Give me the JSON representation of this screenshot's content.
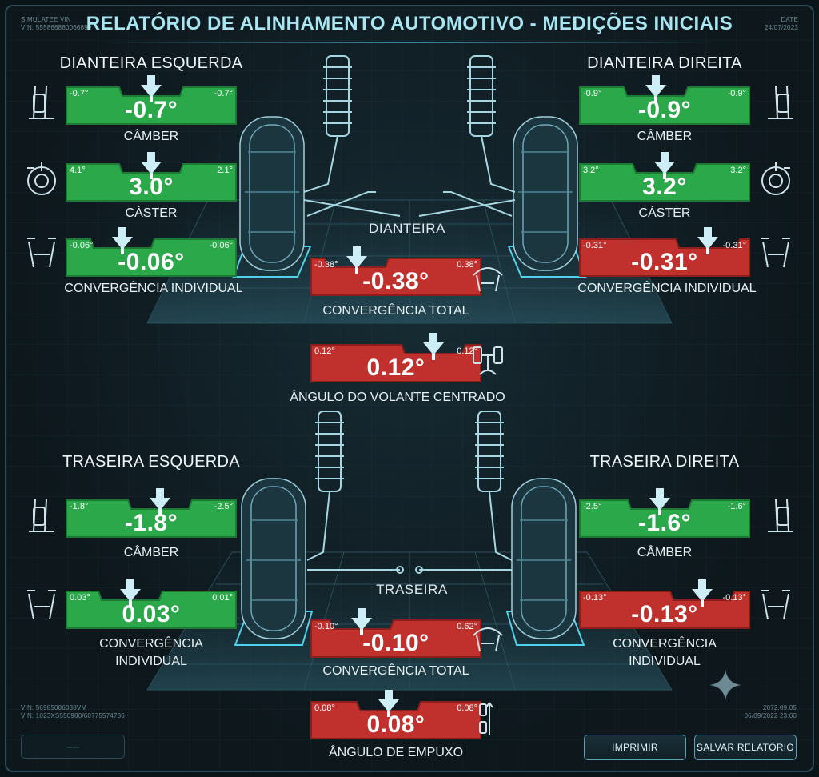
{
  "header": {
    "title": "RELATÓRIO DE ALINHAMENTO AUTOMOTIVO - MEDIÇÕES INICIAIS",
    "vin_label": "SIMULATEE VIN",
    "vin_value": "VIN: 555866880066899",
    "date_label": "DATE",
    "date_value": "24/07/2023"
  },
  "front": {
    "axle_label": "DIANTEIRA",
    "left_title": "DIANTEIRA ESQUERDA",
    "right_title": "DIANTEIRA DIREITA",
    "left": {
      "camber": {
        "label": "CÂMBER",
        "value": "-0.7°",
        "min": "-0.7°",
        "max": "-0.7°",
        "status": "ok",
        "marker": 0.5
      },
      "caster": {
        "label": "CÁSTER",
        "value": "3.0°",
        "min": "4.1°",
        "max": "2.1°",
        "status": "ok",
        "marker": 0.5
      },
      "toe": {
        "label": "CONVERGÊNCIA INDIVIDUAL",
        "value": "-0.06°",
        "min": "-0.06°",
        "max": "-0.06°",
        "status": "ok",
        "marker": 0.33
      }
    },
    "right": {
      "camber": {
        "label": "CÂMBER",
        "value": "-0.9°",
        "min": "-0.9°",
        "max": "-0.9°",
        "status": "ok",
        "marker": 0.45
      },
      "caster": {
        "label": "CÁSTER",
        "value": "3.2°",
        "min": "3.2°",
        "max": "3.2°",
        "status": "ok",
        "marker": 0.5
      },
      "toe": {
        "label": "CONVERGÊNCIA INDIVIDUAL",
        "value": "-0.31°",
        "min": "-0.31°",
        "max": "-0.31°",
        "status": "bad",
        "marker": 0.75
      }
    },
    "total_toe": {
      "label": "CONVERGÊNCIA TOTAL",
      "value": "-0.38°",
      "min": "-0.38°",
      "max": "0.38°",
      "status": "bad",
      "marker": 0.27
    }
  },
  "steering": {
    "label": "ÂNGULO DO VOLANTE CENTRADO",
    "value": "0.12°",
    "min": "0.12°",
    "max": "0.12°",
    "status": "bad",
    "marker": 0.72
  },
  "rear": {
    "axle_label": "TRASEIRA",
    "left_title": "TRASEIRA ESQUERDA",
    "right_title": "TRASEIRA DIREITA",
    "left": {
      "camber": {
        "label": "CÂMBER",
        "value": "-1.8°",
        "min": "-1.8°",
        "max": "-2.5°",
        "status": "ok",
        "marker": 0.55
      },
      "toe": {
        "label_line1": "CONVERGÊNCIA",
        "label_line2": "INDIVIDUAL",
        "value": "0.03°",
        "min": "0.03°",
        "max": "0.01°",
        "status": "ok",
        "marker": 0.38
      }
    },
    "right": {
      "camber": {
        "label": "CÂMBER",
        "value": "-1.6°",
        "min": "-2.5°",
        "max": "-1.6°",
        "status": "ok",
        "marker": 0.47
      },
      "toe": {
        "label_line1": "CONVERGÊNCIA",
        "label_line2": "INDIVIDUAL",
        "value": "-0.13°",
        "min": "-0.13°",
        "max": "-0.13°",
        "status": "bad",
        "marker": 0.72
      }
    },
    "total_toe": {
      "label": "CONVERGÊNCIA TOTAL",
      "value": "-0.10°",
      "min": "-0.10°",
      "max": "0.62°",
      "status": "bad",
      "marker": 0.3
    }
  },
  "thrust": {
    "label": "ÂNGULO DE EMPUXO",
    "value": "0.08°",
    "min": "0.08°",
    "max": "0.08°",
    "status": "bad",
    "marker": 0.46
  },
  "footer": {
    "vin_line1": "VIN: 56985086038VM",
    "vin_line2": "VIN: 1023XS550980/6077557478​6",
    "timestamp_line1": "2072.09.05",
    "timestamp_line2": "06/09/2022 23:00",
    "print_button": "IMPRIMIR",
    "save_button": "SALVAR RELATÓRIO",
    "blank_button": "----"
  },
  "colors": {
    "ok": "#2aa84a",
    "ok_dark": "#1d7a34",
    "bad": "#c0302c",
    "bad_dark": "#8c1f1c",
    "marker": "#cdeef6",
    "accent": "#a9e6f2"
  },
  "icons": {
    "camber": "camber-icon",
    "caster": "caster-icon",
    "toe": "toe-icon",
    "total_toe": "total-toe-icon",
    "steering": "steering-icon",
    "thrust": "thrust-icon"
  }
}
